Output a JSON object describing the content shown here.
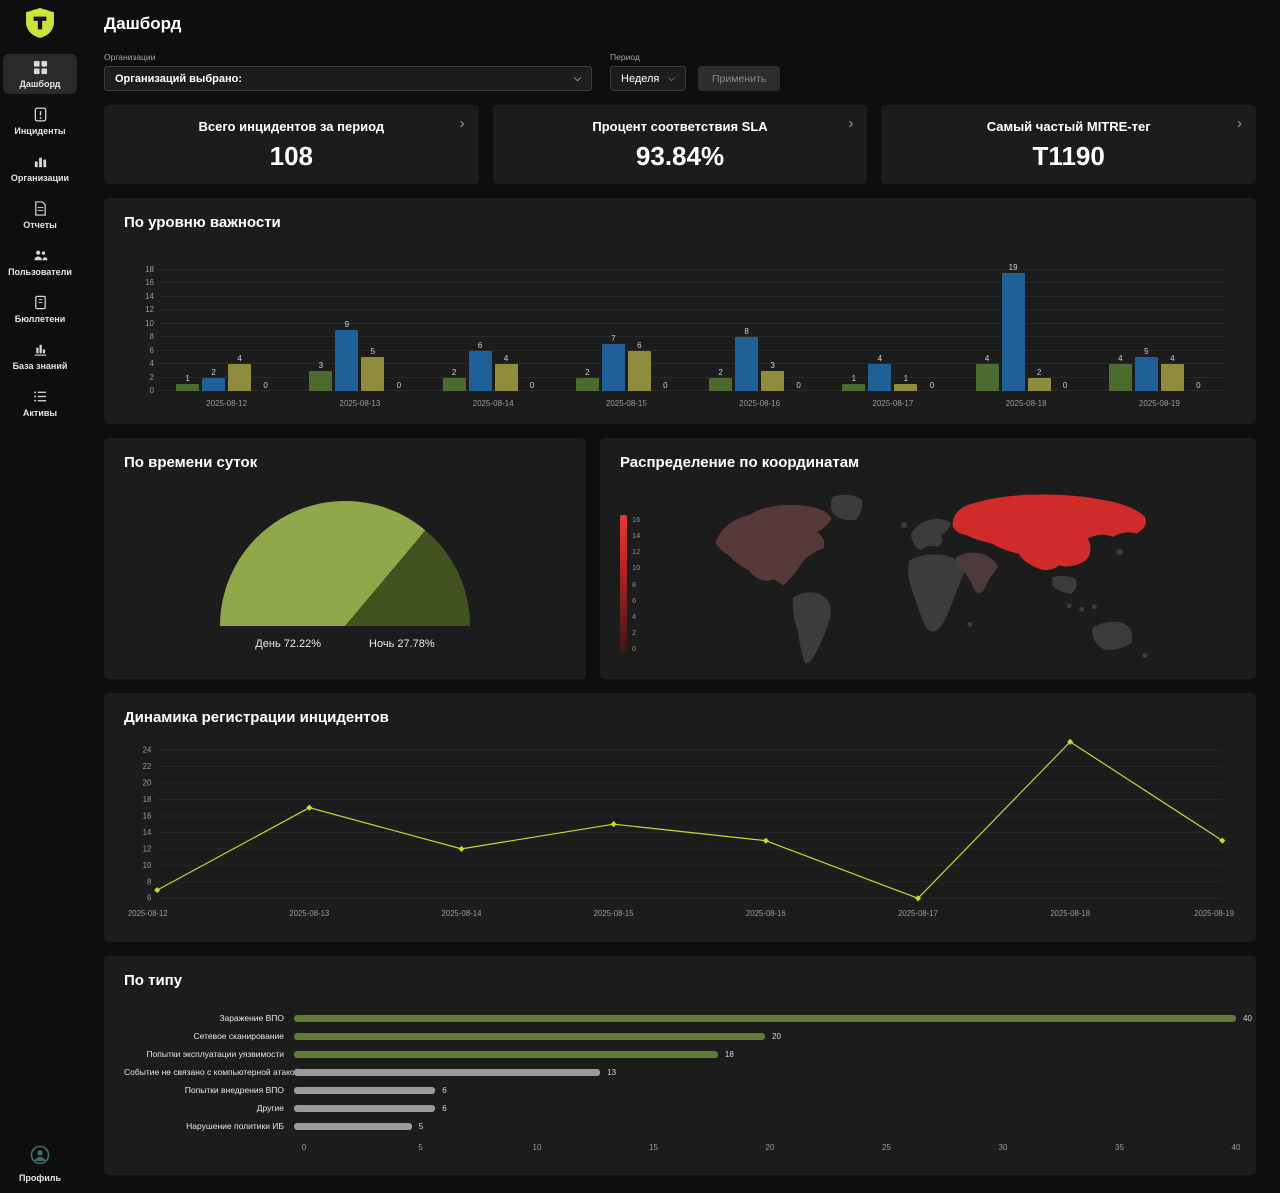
{
  "app": {
    "title": "Дашборд"
  },
  "sidebar": {
    "items": [
      {
        "label": "Дашборд",
        "icon": "dashboard-icon",
        "active": true
      },
      {
        "label": "Инциденты",
        "icon": "incidents-icon",
        "active": false
      },
      {
        "label": "Организации",
        "icon": "organizations-icon",
        "active": false
      },
      {
        "label": "Отчеты",
        "icon": "reports-icon",
        "active": false
      },
      {
        "label": "Пользователи",
        "icon": "users-icon",
        "active": false
      },
      {
        "label": "Бюллетени",
        "icon": "bulletins-icon",
        "active": false
      },
      {
        "label": "База знаний",
        "icon": "knowledge-icon",
        "active": false
      },
      {
        "label": "Активы",
        "icon": "assets-icon",
        "active": false
      }
    ],
    "profile_label": "Профиль"
  },
  "filters": {
    "org_label": "Организации",
    "org_value": "Организаций выбрано:",
    "period_label": "Период",
    "period_value": "Неделя",
    "apply_label": "Применить"
  },
  "stats": [
    {
      "title": "Всего инцидентов за период",
      "value": "108"
    },
    {
      "title": "Процент соответствия SLA",
      "value": "93.84%"
    },
    {
      "title": "Самый частый MITRE-тег",
      "value": "T1190"
    }
  ],
  "chart_data": [
    {
      "id": "severity",
      "type": "bar",
      "title": "По уровню важности",
      "categories": [
        "2025-08-12",
        "2025-08-13",
        "2025-08-14",
        "2025-08-15",
        "2025-08-16",
        "2025-08-17",
        "2025-08-18",
        "2025-08-19"
      ],
      "series": [
        {
          "name": "series-1",
          "color": "#4c6b2f",
          "values": [
            1,
            3,
            2,
            2,
            2,
            1,
            4,
            4
          ]
        },
        {
          "name": "series-2",
          "color": "#1f6096",
          "values": [
            2,
            9,
            6,
            7,
            8,
            4,
            19,
            5
          ]
        },
        {
          "name": "series-3",
          "color": "#8f8c3e",
          "values": [
            4,
            5,
            4,
            6,
            3,
            1,
            2,
            4
          ]
        },
        {
          "name": "series-4",
          "color": "#8a8a8a",
          "values": [
            0,
            0,
            0,
            0,
            0,
            0,
            0,
            0
          ]
        }
      ],
      "ylim": [
        0,
        18
      ],
      "yticks": [
        0,
        2,
        4,
        6,
        8,
        10,
        12,
        14,
        16,
        18
      ],
      "grid": true,
      "legend_position": "none"
    },
    {
      "id": "day-night",
      "type": "pie",
      "shape": "semicircle",
      "title": "По времени суток",
      "slices": [
        {
          "label": "День 72.22%",
          "value": 72.22,
          "color": "#8fa84a"
        },
        {
          "label": "Ночь 27.78%",
          "value": 27.78,
          "color": "#41521f"
        }
      ]
    },
    {
      "id": "geo",
      "type": "heatmap",
      "title": "Распределение по координатам",
      "legend": {
        "min": 0,
        "max": 16,
        "ticks": [
          16,
          14,
          12,
          10,
          8,
          6,
          4,
          2,
          0
        ]
      },
      "regions": [
        {
          "name": "Russia",
          "value": 16
        },
        {
          "name": "USA",
          "value": 3
        },
        {
          "name": "India",
          "value": 2
        }
      ]
    },
    {
      "id": "dynamics",
      "type": "line",
      "title": "Динамика регистрации инцидентов",
      "x": [
        "2025-08-12",
        "2025-08-13",
        "2025-08-14",
        "2025-08-15",
        "2025-08-16",
        "2025-08-17",
        "2025-08-18",
        "2025-08-19"
      ],
      "values": [
        7,
        17,
        12,
        15,
        13,
        6,
        25,
        13
      ],
      "ylim": [
        6,
        24
      ],
      "yticks": [
        6,
        8,
        10,
        12,
        14,
        16,
        18,
        20,
        22,
        24
      ],
      "color": "#c9da2f",
      "grid": true
    },
    {
      "id": "types",
      "type": "bar",
      "orientation": "horizontal",
      "title": "По типу",
      "categories": [
        "Заражение ВПО",
        "Сетевое сканирование",
        "Попытки эксплуатации уязвимости",
        "Событие не связано с компьютерной атакой",
        "Попытки внедрения ВПО",
        "Другие",
        "Нарушение политики ИБ"
      ],
      "values": [
        40,
        20,
        18,
        13,
        6,
        6,
        5
      ],
      "colors": [
        "#5f7d33",
        "#5f7d33",
        "#5f7d33",
        "#9a9a9a",
        "#9a9a9a",
        "#9a9a9a",
        "#9a9a9a"
      ],
      "xticks": [
        0,
        5,
        10,
        15,
        20,
        25,
        30,
        35,
        40
      ]
    }
  ]
}
